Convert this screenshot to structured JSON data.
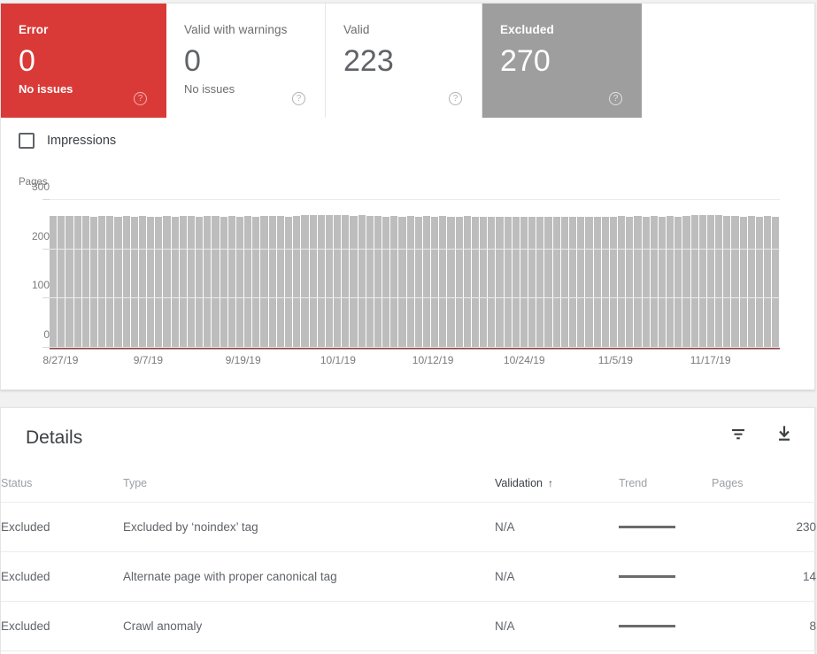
{
  "summary_tabs": [
    {
      "id": "error",
      "label": "Error",
      "value": "0",
      "sub": "No issues",
      "help": "help-icon",
      "state": "normal",
      "color": "#d93a38"
    },
    {
      "id": "warnings",
      "label": "Valid with warnings",
      "value": "0",
      "sub": "No issues",
      "help": "help-icon",
      "state": "normal",
      "color": "#ffffff"
    },
    {
      "id": "valid",
      "label": "Valid",
      "value": "223",
      "sub": "",
      "help": "help-icon",
      "state": "normal",
      "color": "#ffffff"
    },
    {
      "id": "excluded",
      "label": "Excluded",
      "value": "270",
      "sub": "",
      "help": "help-icon",
      "state": "selected",
      "color": "#9e9e9e"
    }
  ],
  "legend": {
    "impressions_label": "Impressions",
    "checked": false
  },
  "chart_data": {
    "type": "bar",
    "title": "",
    "ylabel": "Pages",
    "xlabel": "",
    "ylim": [
      0,
      300
    ],
    "yticks": [
      0,
      100,
      200,
      300
    ],
    "grid": true,
    "legend_position": "top-left",
    "xtick_labels": [
      "8/27/19",
      "9/7/19",
      "9/19/19",
      "10/1/19",
      "10/12/19",
      "10/24/19",
      "11/5/19",
      "11/17/19"
    ],
    "xtick_positions_pct": [
      1.5,
      13.5,
      26.5,
      39.5,
      52.5,
      65.0,
      77.5,
      90.5
    ],
    "series": [
      {
        "name": "Excluded",
        "color": "#bdbdbd",
        "values": [
          268,
          267,
          267,
          268,
          267,
          266,
          267,
          267,
          266,
          267,
          266,
          267,
          266,
          266,
          267,
          266,
          267,
          267,
          266,
          268,
          267,
          266,
          267,
          266,
          267,
          266,
          267,
          268,
          267,
          266,
          267,
          270,
          270,
          269,
          270,
          269,
          270,
          268,
          269,
          268,
          267,
          266,
          267,
          266,
          267,
          266,
          267,
          266,
          267,
          266,
          266,
          267,
          266,
          265,
          266,
          265,
          266,
          265,
          266,
          265,
          266,
          265,
          266,
          265,
          266,
          265,
          266,
          265,
          266,
          266,
          267,
          266,
          267,
          266,
          267,
          266,
          267,
          266,
          268,
          269,
          269,
          270,
          269,
          268,
          267,
          266,
          267,
          266,
          267,
          266
        ]
      },
      {
        "name": "Error",
        "color": "#a8383c",
        "values": [
          0,
          0,
          0,
          0,
          0,
          0,
          0,
          0,
          0,
          0,
          0,
          0,
          0,
          0,
          0,
          0,
          0,
          0,
          0,
          0,
          0,
          0,
          0,
          0,
          0,
          0,
          0,
          0,
          0,
          0,
          0,
          0,
          0,
          0,
          0,
          0,
          0,
          0,
          0,
          0,
          0,
          0,
          0,
          0,
          0,
          0,
          0,
          0,
          0,
          0,
          0,
          0,
          0,
          0,
          0,
          0,
          0,
          0,
          0,
          0,
          0,
          0,
          0,
          0,
          0,
          0,
          0,
          0,
          0,
          0,
          0,
          0,
          0,
          0,
          0,
          0,
          0,
          0,
          0,
          0,
          0,
          0,
          0,
          0,
          0,
          0,
          0,
          0,
          0,
          0
        ]
      }
    ]
  },
  "details": {
    "title": "Details",
    "filter_icon": "filter-icon",
    "export_icon": "download-icon",
    "columns": [
      {
        "key": "status",
        "label": "Status",
        "sorted": false
      },
      {
        "key": "type",
        "label": "Type",
        "sorted": false
      },
      {
        "key": "validation",
        "label": "Validation",
        "sorted": true,
        "sort_arrow": "↑"
      },
      {
        "key": "trend",
        "label": "Trend",
        "sorted": false
      },
      {
        "key": "pages",
        "label": "Pages",
        "sorted": false
      }
    ],
    "rows": [
      {
        "status": "Excluded",
        "type": "Excluded by ‘noindex’ tag",
        "validation": "N/A",
        "trend": "flat",
        "pages": "230"
      },
      {
        "status": "Excluded",
        "type": "Alternate page with proper canonical tag",
        "validation": "N/A",
        "trend": "flat",
        "pages": "14"
      },
      {
        "status": "Excluded",
        "type": "Crawl anomaly",
        "validation": "N/A",
        "trend": "flat",
        "pages": "8"
      }
    ]
  }
}
